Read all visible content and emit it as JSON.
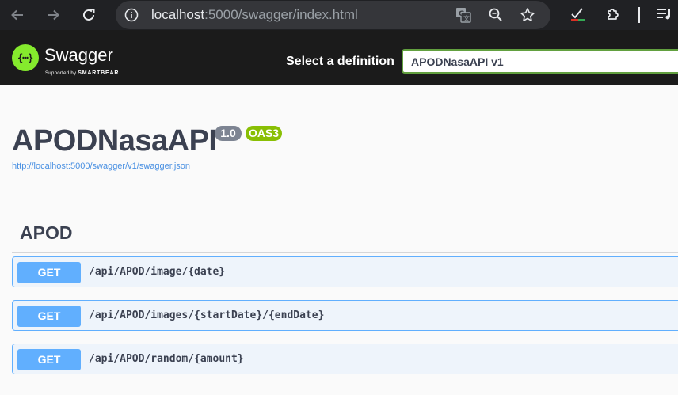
{
  "browser": {
    "url_host": "localhost",
    "url_path": ":5000/swagger/index.html",
    "icons": [
      "back-arrow-icon",
      "forward-arrow-icon",
      "reload-icon",
      "info-icon",
      "translate-icon",
      "zoom-icon",
      "star-icon",
      "extension-check-icon",
      "puzzle-icon",
      "media-queue-icon"
    ]
  },
  "topbar": {
    "brand": "Swagger",
    "supported_prefix": "Supported by",
    "supported_brand": "SMARTBEAR",
    "definition_label": "Select a definition",
    "definition_value": "APODNasaAPI v1",
    "accent": "#85ea2d"
  },
  "info": {
    "title": "APODNasaAPI",
    "version": "1.0",
    "oas": "OAS3",
    "spec_url": "http://localhost:5000/swagger/v1/swagger.json"
  },
  "tag": {
    "name": "APOD",
    "operations": [
      {
        "method": "GET",
        "path": "/api/APOD/image/{date}"
      },
      {
        "method": "GET",
        "path": "/api/APOD/images/{startDate}/{endDate}"
      },
      {
        "method": "GET",
        "path": "/api/APOD/random/{amount}"
      }
    ]
  },
  "colors": {
    "get": "#61affe",
    "get_bg": "#eef4fb",
    "text": "#3b4151"
  }
}
